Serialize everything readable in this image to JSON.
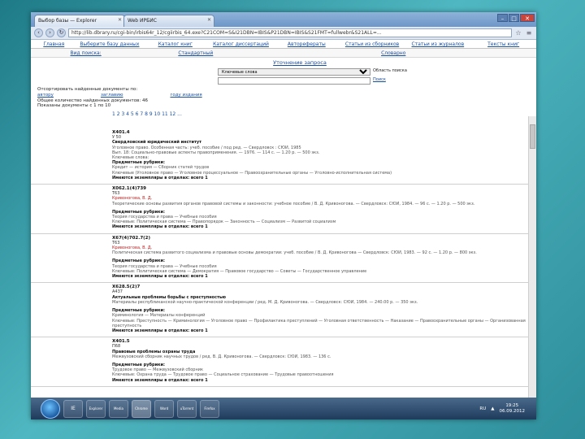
{
  "browser": {
    "tabs": [
      {
        "label": "Выбор базы — Explorer"
      },
      {
        "label": "Web ИРБИС"
      }
    ],
    "url": "http://lib.dbrary.ru/cgi-bin/irbis64r_12/cgiirbis_64.exe?C21COM=S&I21DBN=IBIS&P21DBN=IBIS&S21FMT=fullwebr&S21ALL=...",
    "window_controls": [
      "–",
      "□",
      "✕"
    ]
  },
  "site_nav": {
    "items": [
      "Главная",
      "Выберите базу данных",
      "Каталог книг",
      "Каталог диссертаций",
      "Авторефераты",
      "Статьи из сборников",
      "Статьи из журналов",
      "Тексты книг"
    ]
  },
  "sub_nav": {
    "items": [
      "Вид поиска:",
      "Стандартный",
      "Словарно"
    ]
  },
  "refine": {
    "title": "Уточнение запроса",
    "select_value": "Ключевые слова",
    "label_area": "Область поиска",
    "label_search": "Поиск"
  },
  "info": {
    "line1": "Отсортировать найденные документы по:",
    "sort_options": [
      "автору",
      "заглавию",
      "году издания"
    ],
    "line2": "Общее количество найденных документов: 46",
    "line3": "Показаны документы с 1 по 10"
  },
  "pagination": "1 2 3 4 5 6 7 8 9 10 11 12 ...",
  "results": [
    {
      "code": "X401.4",
      "sub": "У 50",
      "author": "Свердловский юридический институт",
      "lines": [
        "Уголовное право. Особенная часть: учеб. пособие / под ред. — Свердловск : СЮИ, 1985",
        "Вып. 18: Социально-правовые аспекты правоприменения. — 1976. — 114 с. — 1.20 р. — 500 экз.",
        "Ключевые слова:",
        "Предметные рубрики:",
        "Кредит — история — Сборник статей трудов",
        "Ключевые (Уголовное право — Уголовное процессуальное — Правоохранительные органы — Уголовно-исполнительная система)",
        "Имеются экземпляры в отделах: всего 1"
      ]
    },
    {
      "code": "X062.1(4)739",
      "sub": "Т63",
      "author": "Кривоногова, В. Д.",
      "lines": [
        "Теоретические основы развития органов правовой системы и законности: учебное пособие / В. Д. Кривоногова. — Свердловск: СЮИ, 1984. — 96 с. — 1.20 р. — 500 экз.",
        "Предметные рубрики:",
        "Теория государства и права — Учебные пособия",
        "Ключевые: Политическая система — Правопорядок — Законность — Социализм — Развитой социализм",
        "Имеются экземпляры в отделах: всего 1"
      ]
    },
    {
      "code": "X67(4)702.7(2)",
      "sub": "Т63",
      "author": "Кривоногова, В. Д.",
      "lines": [
        "Политическая система развитого социализма и правовые основы демократии: учеб. пособие / В. Д. Кривоногова — Свердловск: СЮИ, 1983. — 92 с. — 1.20 р. — 800 экз.",
        "Предметные рубрики:",
        "Теория государства и права — Учебные пособия",
        "Ключевые: Политическая система — Демократия — Правовое государство — Советы — Государственное управление",
        "Имеются экземпляры в отделах: всего 1"
      ]
    },
    {
      "code": "X628.5(2)7",
      "sub": "А437",
      "author": "Актуальные проблемы борьбы с преступностью",
      "lines": [
        "Материалы республиканской научно-практической конференции / ред. М. Д. Кривоногова. — Свердловск: СЮИ, 1984. — 240.00 р. — 350 экз.",
        "Предметные рубрики:",
        "Криминология — Материалы конференций",
        "Ключевые: Преступность — Криминология — Уголовное право — Профилактика преступлений — Уголовная ответственность — Наказание — Правоохранительные органы — Организованная преступность",
        "Имеются экземпляры в отделах: всего 1"
      ]
    },
    {
      "code": "X401.5",
      "sub": "П68",
      "author": "Правовые проблемы охраны труда",
      "lines": [
        "Межвузовский сборник научных трудов / ред. В. Д. Кривоногова. — Свердловск: СЮИ, 1983. — 136 с.",
        "Предметные рубрики:",
        "Трудовое право — Межвузовский сборник",
        "Ключевые: Охрана труда — Трудовое право — Социальное страхование — Трудовые правоотношения",
        "Имеются экземпляры в отделах: всего 1"
      ]
    }
  ],
  "taskbar": {
    "apps": [
      "IE",
      "Explorer",
      "Media",
      "Chrome",
      "Word",
      "uTorrent",
      "Firefox"
    ],
    "lang": "RU",
    "time": "19:25",
    "date": "06.09.2012"
  }
}
